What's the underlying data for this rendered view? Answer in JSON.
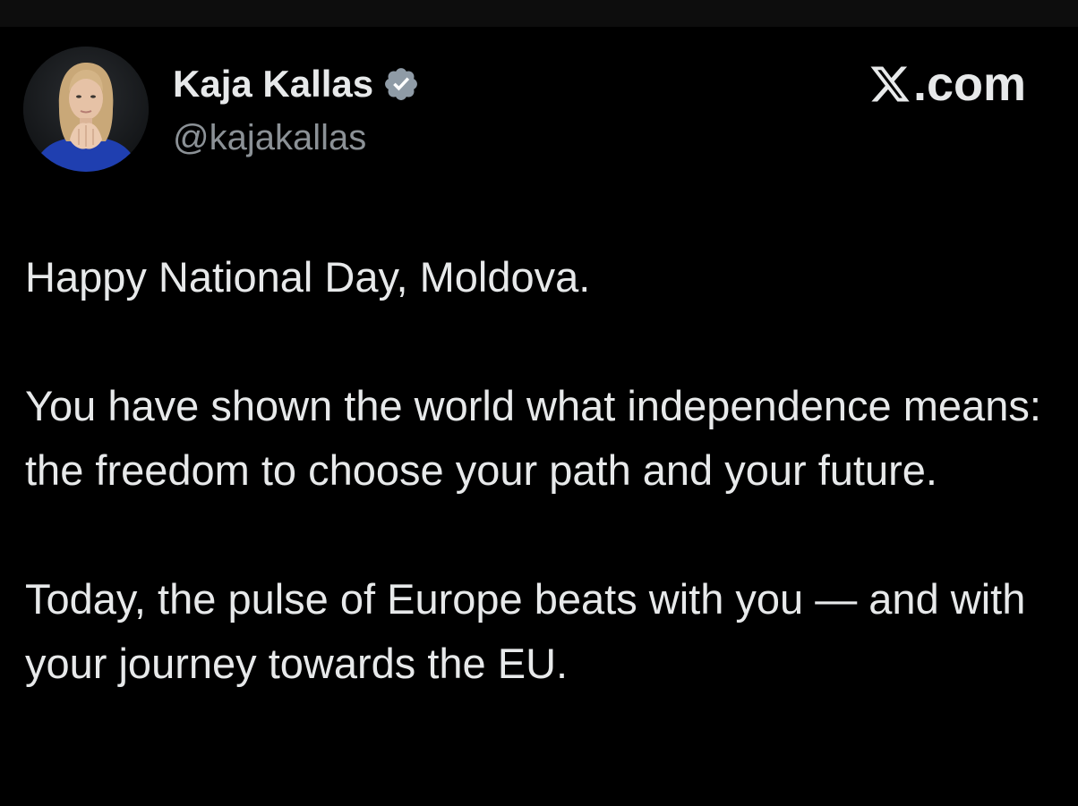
{
  "post": {
    "author": {
      "display_name": "Kaja Kallas",
      "handle": "@kajakallas",
      "verified": true,
      "avatar_icon": "profile-photo-avatar"
    },
    "brand": {
      "logo_icon": "x-logo-icon",
      "text": ".com"
    },
    "body": {
      "paragraphs": [
        "Happy National Day, Moldova.",
        "You have shown the world what independence means: the freedom to choose your path and your future.",
        "Today, the pulse of Europe beats with you — and with your journey towards the EU."
      ]
    }
  },
  "colors": {
    "background": "#000000",
    "text_primary": "#e7e9ea",
    "text_secondary": "#8b9196",
    "verified_badge": "#8f9ba6"
  }
}
